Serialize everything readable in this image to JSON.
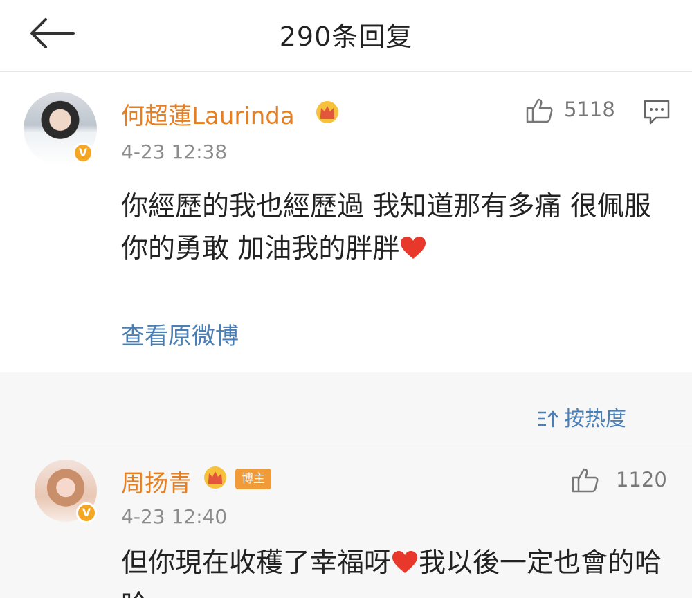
{
  "header": {
    "title": "290条回复",
    "back_icon": "back-arrow-icon"
  },
  "main_comment": {
    "username": "何超蓮Laurinda",
    "timestamp": "4-23 12:38",
    "likes": "5118",
    "content_part1": "你經歷的我也經歷過 我知道那有多痛 很佩服你的勇敢 加油我的胖胖",
    "view_original": "查看原微博",
    "verified_badge": "V"
  },
  "sort": {
    "label": "按热度"
  },
  "reply": {
    "username": "周扬青",
    "badge": "博主",
    "timestamp": "4-23 12:40",
    "likes": "1120",
    "content_part1": "但你現在收穫了幸福呀",
    "content_part2": "我以後一定也會的哈哈",
    "verified_badge": "V"
  },
  "colors": {
    "username": "#e67e22",
    "link": "#4a7fb5",
    "badge": "#f19a38",
    "verified": "#f5a623",
    "heart": "#e8372b"
  }
}
